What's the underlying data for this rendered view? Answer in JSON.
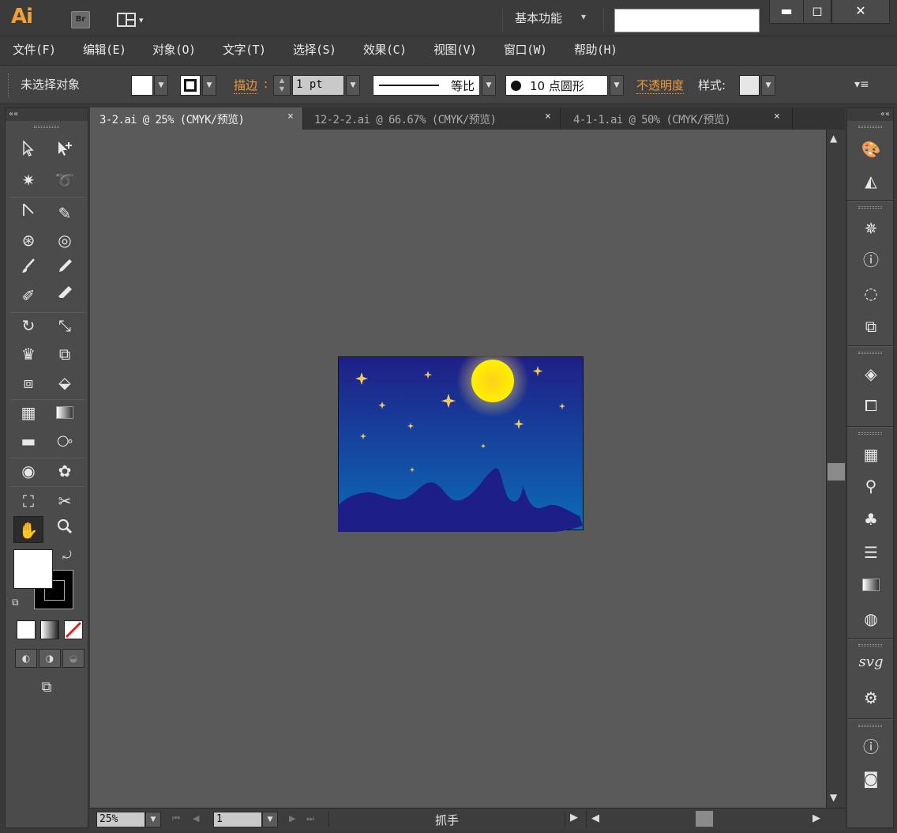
{
  "app": {
    "logo": "Ai",
    "bridge_label": "Br",
    "workspace": "基本功能",
    "window_controls": {
      "minimize": "▬",
      "maximize": "◻",
      "close": "✕"
    }
  },
  "menu": [
    "文件(F)",
    "编辑(E)",
    "对象(O)",
    "文字(T)",
    "选择(S)",
    "效果(C)",
    "视图(V)",
    "窗口(W)",
    "帮助(H)"
  ],
  "control_bar": {
    "selection_status": "未选择对象",
    "stroke_label": "描边",
    "stroke_colon": ":",
    "stroke_weight": "1 pt",
    "profile_label": "等比",
    "brush_size": "10",
    "brush_label": "点圆形",
    "opacity_label": "不透明度",
    "style_label": "样式:",
    "fill_color": "#ffffff",
    "stroke_color": "#000000"
  },
  "tabs": [
    {
      "label": "3-2.ai @ 25% (CMYK/预览)",
      "active": true
    },
    {
      "label": "12-2-2.ai @ 66.67% (CMYK/预览)",
      "active": false
    },
    {
      "label": "4-1-1.ai @ 50% (CMYK/预览)",
      "active": false
    }
  ],
  "tab_close": "×",
  "status": {
    "zoom": "25%",
    "page": "1",
    "current_tool": "抓手"
  },
  "colors": {
    "accent": "#f09838",
    "logo": "#f2a033",
    "canvas": "#5a5a5a",
    "sky_top": "#1f1f86",
    "sky_bottom": "#0b6bb8",
    "mountain": "#1e1e88",
    "moon": "#ffe000",
    "star": "#f0c860"
  },
  "icons": {
    "collapse_left": "««",
    "collapse_right": "««",
    "panel_menu": "▾≡"
  }
}
